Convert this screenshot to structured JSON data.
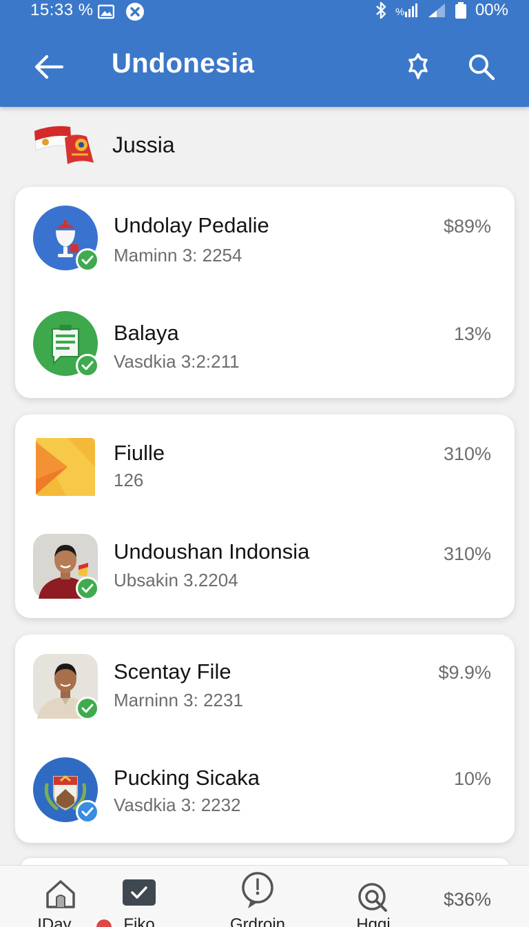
{
  "status_bar": {
    "time": "15:33 %",
    "battery": "00%"
  },
  "header": {
    "title": "Undonesia"
  },
  "subheader": {
    "label": "Jussia"
  },
  "cards": [
    {
      "items": [
        {
          "title": "Undolay Pedalie",
          "subtitle": "Maminn 3: 2254",
          "percent": "$89%",
          "icon": "trophy-icon",
          "badge": "verified-check-icon"
        },
        {
          "title": "Balaya",
          "subtitle": "Vasdkia 3:2:211",
          "percent": "13%",
          "icon": "chat-document-icon",
          "badge": "verified-check-icon"
        }
      ]
    },
    {
      "items": [
        {
          "title": "Fiulle",
          "subtitle": "126",
          "percent": "310%",
          "icon": "folder-icon"
        },
        {
          "title": "Undoushan Indonsia",
          "subtitle": "Ubsakin 3.2204",
          "percent": "310%",
          "icon": "person-avatar",
          "badge": "verified-check-icon"
        }
      ]
    },
    {
      "items": [
        {
          "title": "Scentay File",
          "subtitle": "Marninn 3: 2231",
          "percent": "$9.9%",
          "icon": "person-avatar",
          "badge": "verified-check-icon"
        },
        {
          "title": "Pucking Sicaka",
          "subtitle": "Vasdkia 3: 2232",
          "percent": "10%",
          "icon": "crest-emblem-icon",
          "badge": "verified-check-icon"
        }
      ]
    }
  ],
  "bottom_nav": {
    "items": [
      {
        "label": "IDay...",
        "icon": "home-icon"
      },
      {
        "label": "Fiko",
        "icon": "check-square-icon"
      },
      {
        "label": "Grdroin",
        "icon": "clock-bubble-icon"
      },
      {
        "label": "Hqqi",
        "icon": "search-circle-icon"
      }
    ],
    "percent": "$36%"
  },
  "colors": {
    "app_bar": "#3b78c9",
    "badge_green": "#3faa4e",
    "badge_blue": "#3a8de0",
    "background": "#f1f1f2"
  }
}
